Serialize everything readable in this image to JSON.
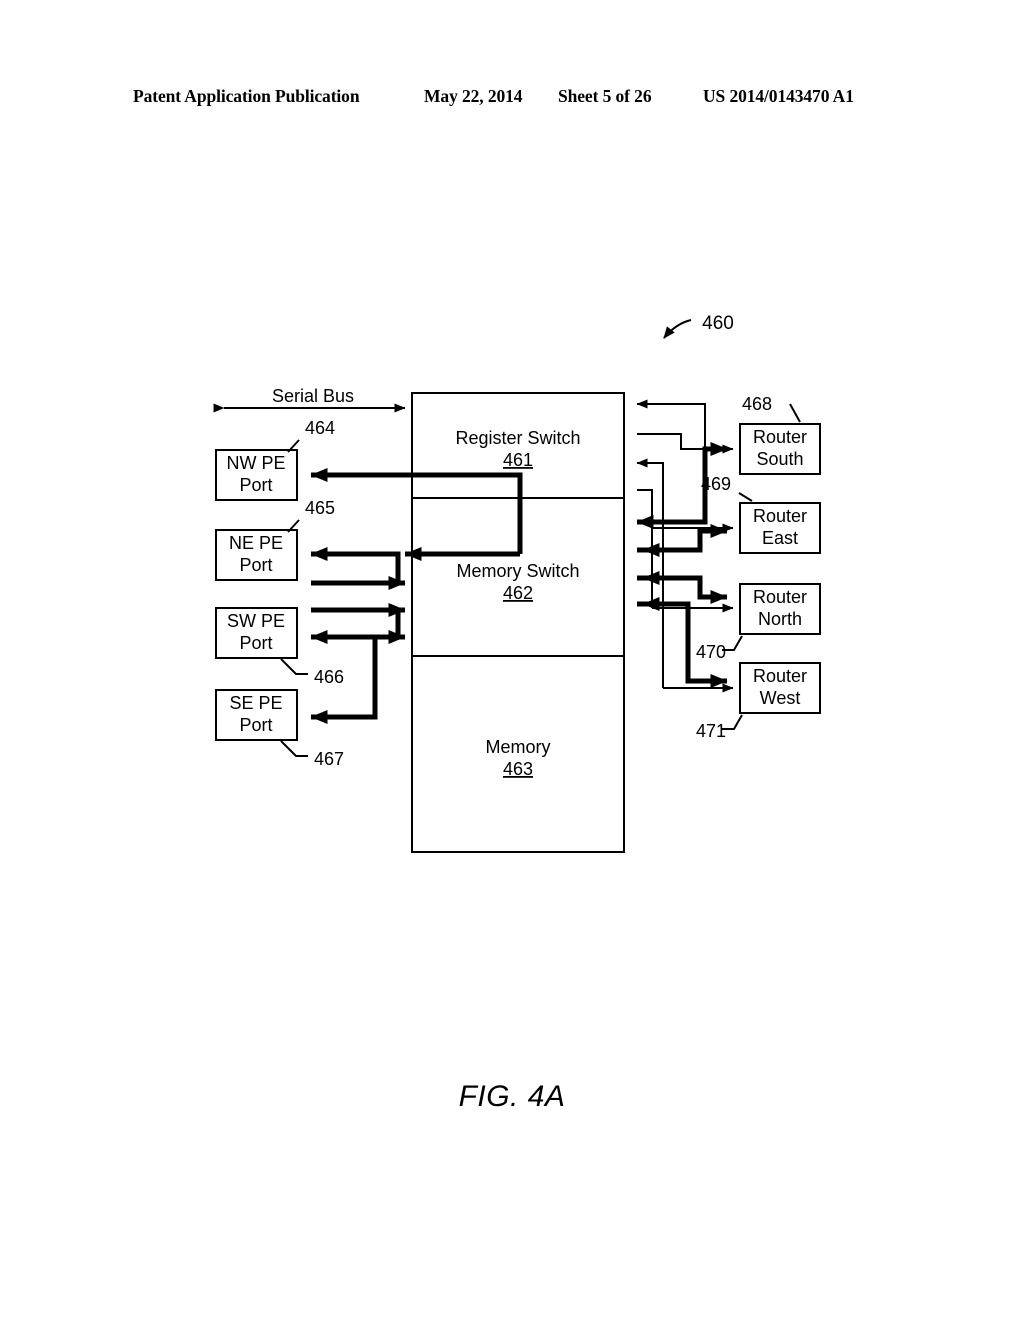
{
  "header": {
    "publication": "Patent Application Publication",
    "date": "May 22, 2014",
    "sheet": "Sheet 5 of 26",
    "patent_number": "US 2014/0143470 A1"
  },
  "figure": {
    "caption": "FIG. 4A",
    "callout": "460",
    "serial_bus_label": "Serial Bus",
    "center_blocks": [
      {
        "title": "Register Switch",
        "ref": "461"
      },
      {
        "title": "Memory Switch",
        "ref": "462"
      },
      {
        "title": "Memory",
        "ref": "463"
      }
    ],
    "pe_ports": [
      {
        "line1": "NW PE",
        "line2": "Port",
        "ref": "464"
      },
      {
        "line1": "NE PE",
        "line2": "Port",
        "ref": "465"
      },
      {
        "line1": "SW PE",
        "line2": "Port",
        "ref": "466"
      },
      {
        "line1": "SE PE",
        "line2": "Port",
        "ref": "467"
      }
    ],
    "routers": [
      {
        "line1": "Router",
        "line2": "South",
        "ref": "468"
      },
      {
        "line1": "Router",
        "line2": "East",
        "ref": "469"
      },
      {
        "line1": "Router",
        "line2": "North",
        "ref": "470"
      },
      {
        "line1": "Router",
        "line2": "West",
        "ref": "471"
      }
    ]
  },
  "colors": {
    "ink": "#000000",
    "paper": "#ffffff"
  }
}
